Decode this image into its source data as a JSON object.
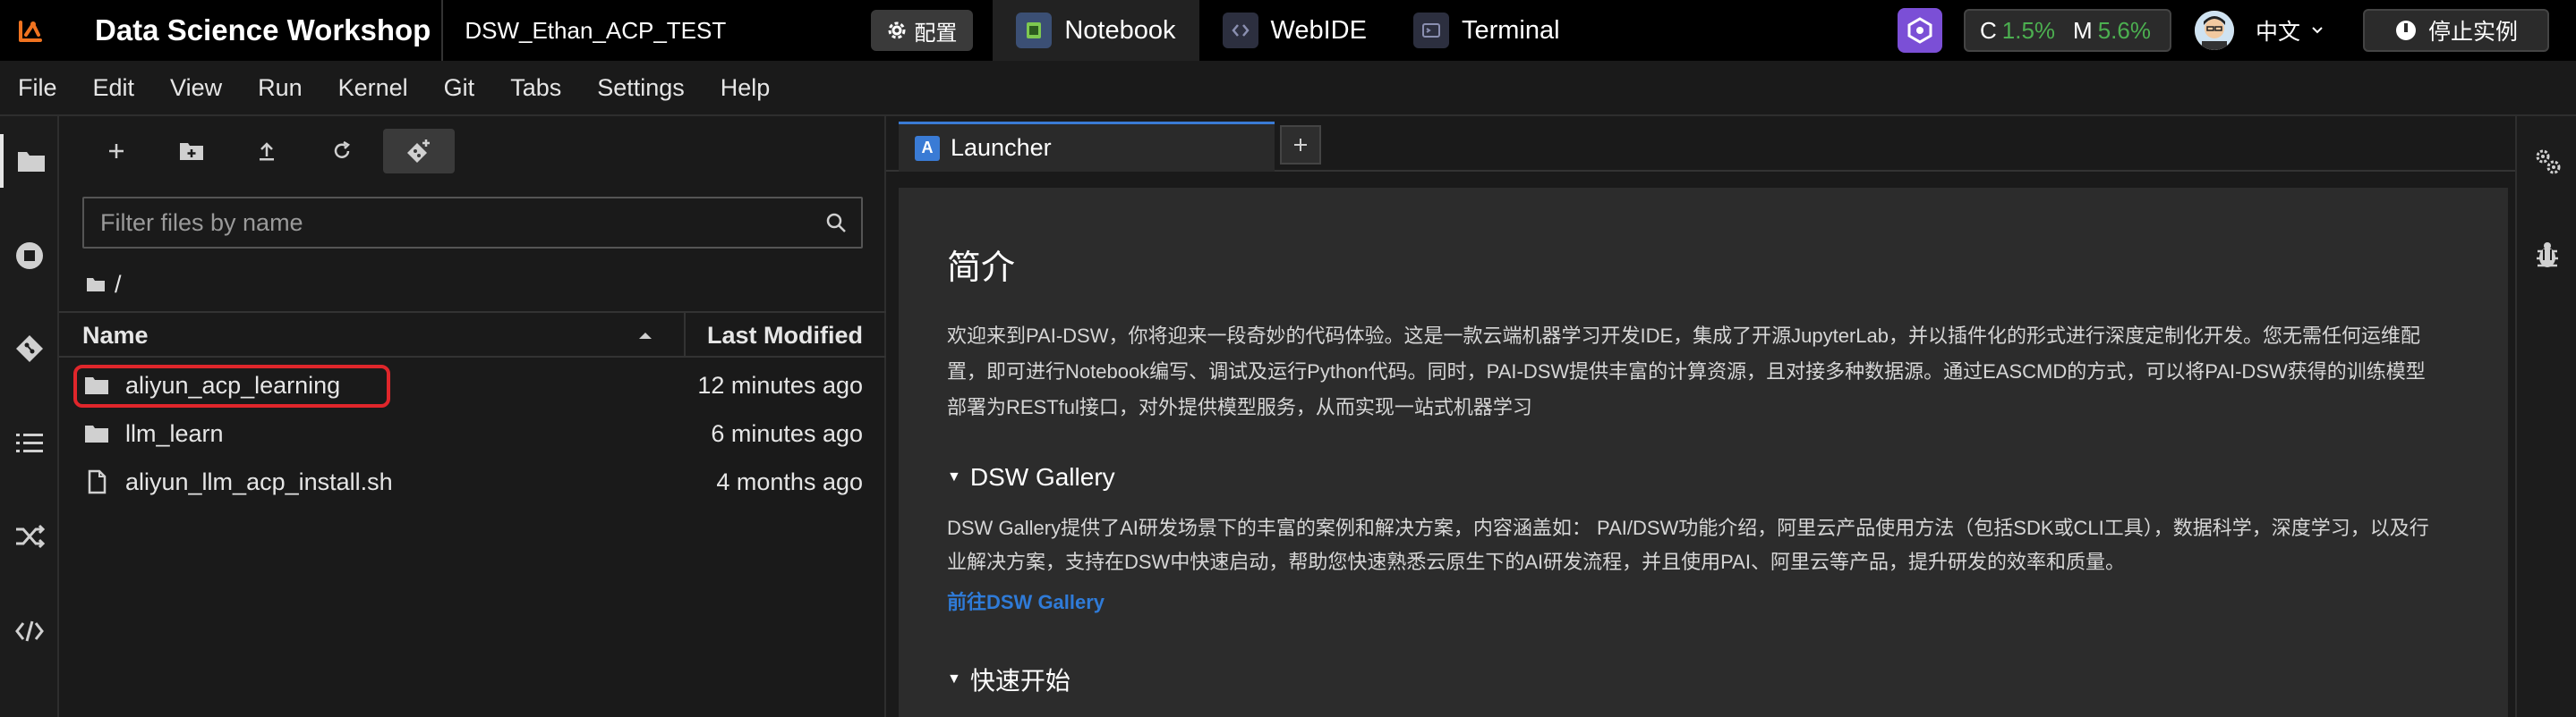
{
  "topbar": {
    "app_title": "Data Science Workshop",
    "instance_name": "DSW_Ethan_ACP_TEST",
    "config_label": "配置",
    "tabs": [
      {
        "label": "Notebook",
        "icon": "notebook-icon"
      },
      {
        "label": "WebIDE",
        "icon": "webide-icon"
      },
      {
        "label": "Terminal",
        "icon": "terminal-icon"
      }
    ],
    "usage": {
      "cpu_label": "C",
      "cpu_value": "1.5%",
      "mem_label": "M",
      "mem_value": "5.6%"
    },
    "language": "中文",
    "stop_label": "停止实例",
    "colors": {
      "usage_value": "#4caf50",
      "ai_icon_bg": "#7b4fd6",
      "logo": "#f07320"
    }
  },
  "menubar": {
    "items": [
      "File",
      "Edit",
      "View",
      "Run",
      "Kernel",
      "Git",
      "Tabs",
      "Settings",
      "Help"
    ]
  },
  "activity_bar": {
    "icons": [
      "folder-icon",
      "running-icon",
      "git-icon",
      "toc-icon",
      "extensions-icon",
      "code-icon"
    ]
  },
  "file_browser": {
    "toolbar": [
      "new-launcher-icon",
      "new-folder-icon",
      "upload-icon",
      "refresh-icon",
      "git-clone-icon"
    ],
    "filter_placeholder": "Filter files by name",
    "breadcrumb": "/",
    "columns": {
      "name": "Name",
      "modified": "Last Modified"
    },
    "files": [
      {
        "name": "aliyun_acp_learning",
        "type": "folder",
        "modified": "12 minutes ago",
        "highlighted": true
      },
      {
        "name": "llm_learn",
        "type": "folder",
        "modified": "6 minutes ago",
        "highlighted": false
      },
      {
        "name": "aliyun_llm_acp_install.sh",
        "type": "file",
        "modified": "4 months ago",
        "highlighted": false
      }
    ],
    "highlight_color": "#e0262b"
  },
  "dock": {
    "tab_label": "Launcher",
    "add_tab_label": "+",
    "launcher": {
      "title": "简介",
      "intro": "欢迎来到PAI-DSW，你将迎来一段奇妙的代码体验。这是一款云端机器学习开发IDE，集成了开源JupyterLab，并以插件化的形式进行深度定制化开发。您无需任何运维配置，即可进行Notebook编写、调试及运行Python代码。同时，PAI-DSW提供丰富的计算资源，且对接多种数据源。通过EASCMD的方式，可以将PAI-DSW获得的训练模型部署为RESTful接口，对外提供模型服务，从而实现一站式机器学习",
      "gallery_title": "DSW Gallery",
      "gallery_desc": "DSW Gallery提供了AI研发场景下的丰富的案例和解决方案，内容涵盖如： PAI/DSW功能介绍，阿里云产品使用方法（包括SDK或CLI工具），数据科学，深度学习，以及行业解决方案，支持在DSW中快速启动，帮助您快速熟悉云原生下的AI研发流程，并且使用PAI、阿里云等产品，提升研发的效率和质量。",
      "gallery_link": "前往DSW Gallery",
      "quickstart_title": "快速开始",
      "link_color": "#2f7bd8"
    }
  },
  "right_bar": {
    "icons": [
      "property-inspector-icon",
      "debugger-icon"
    ]
  }
}
